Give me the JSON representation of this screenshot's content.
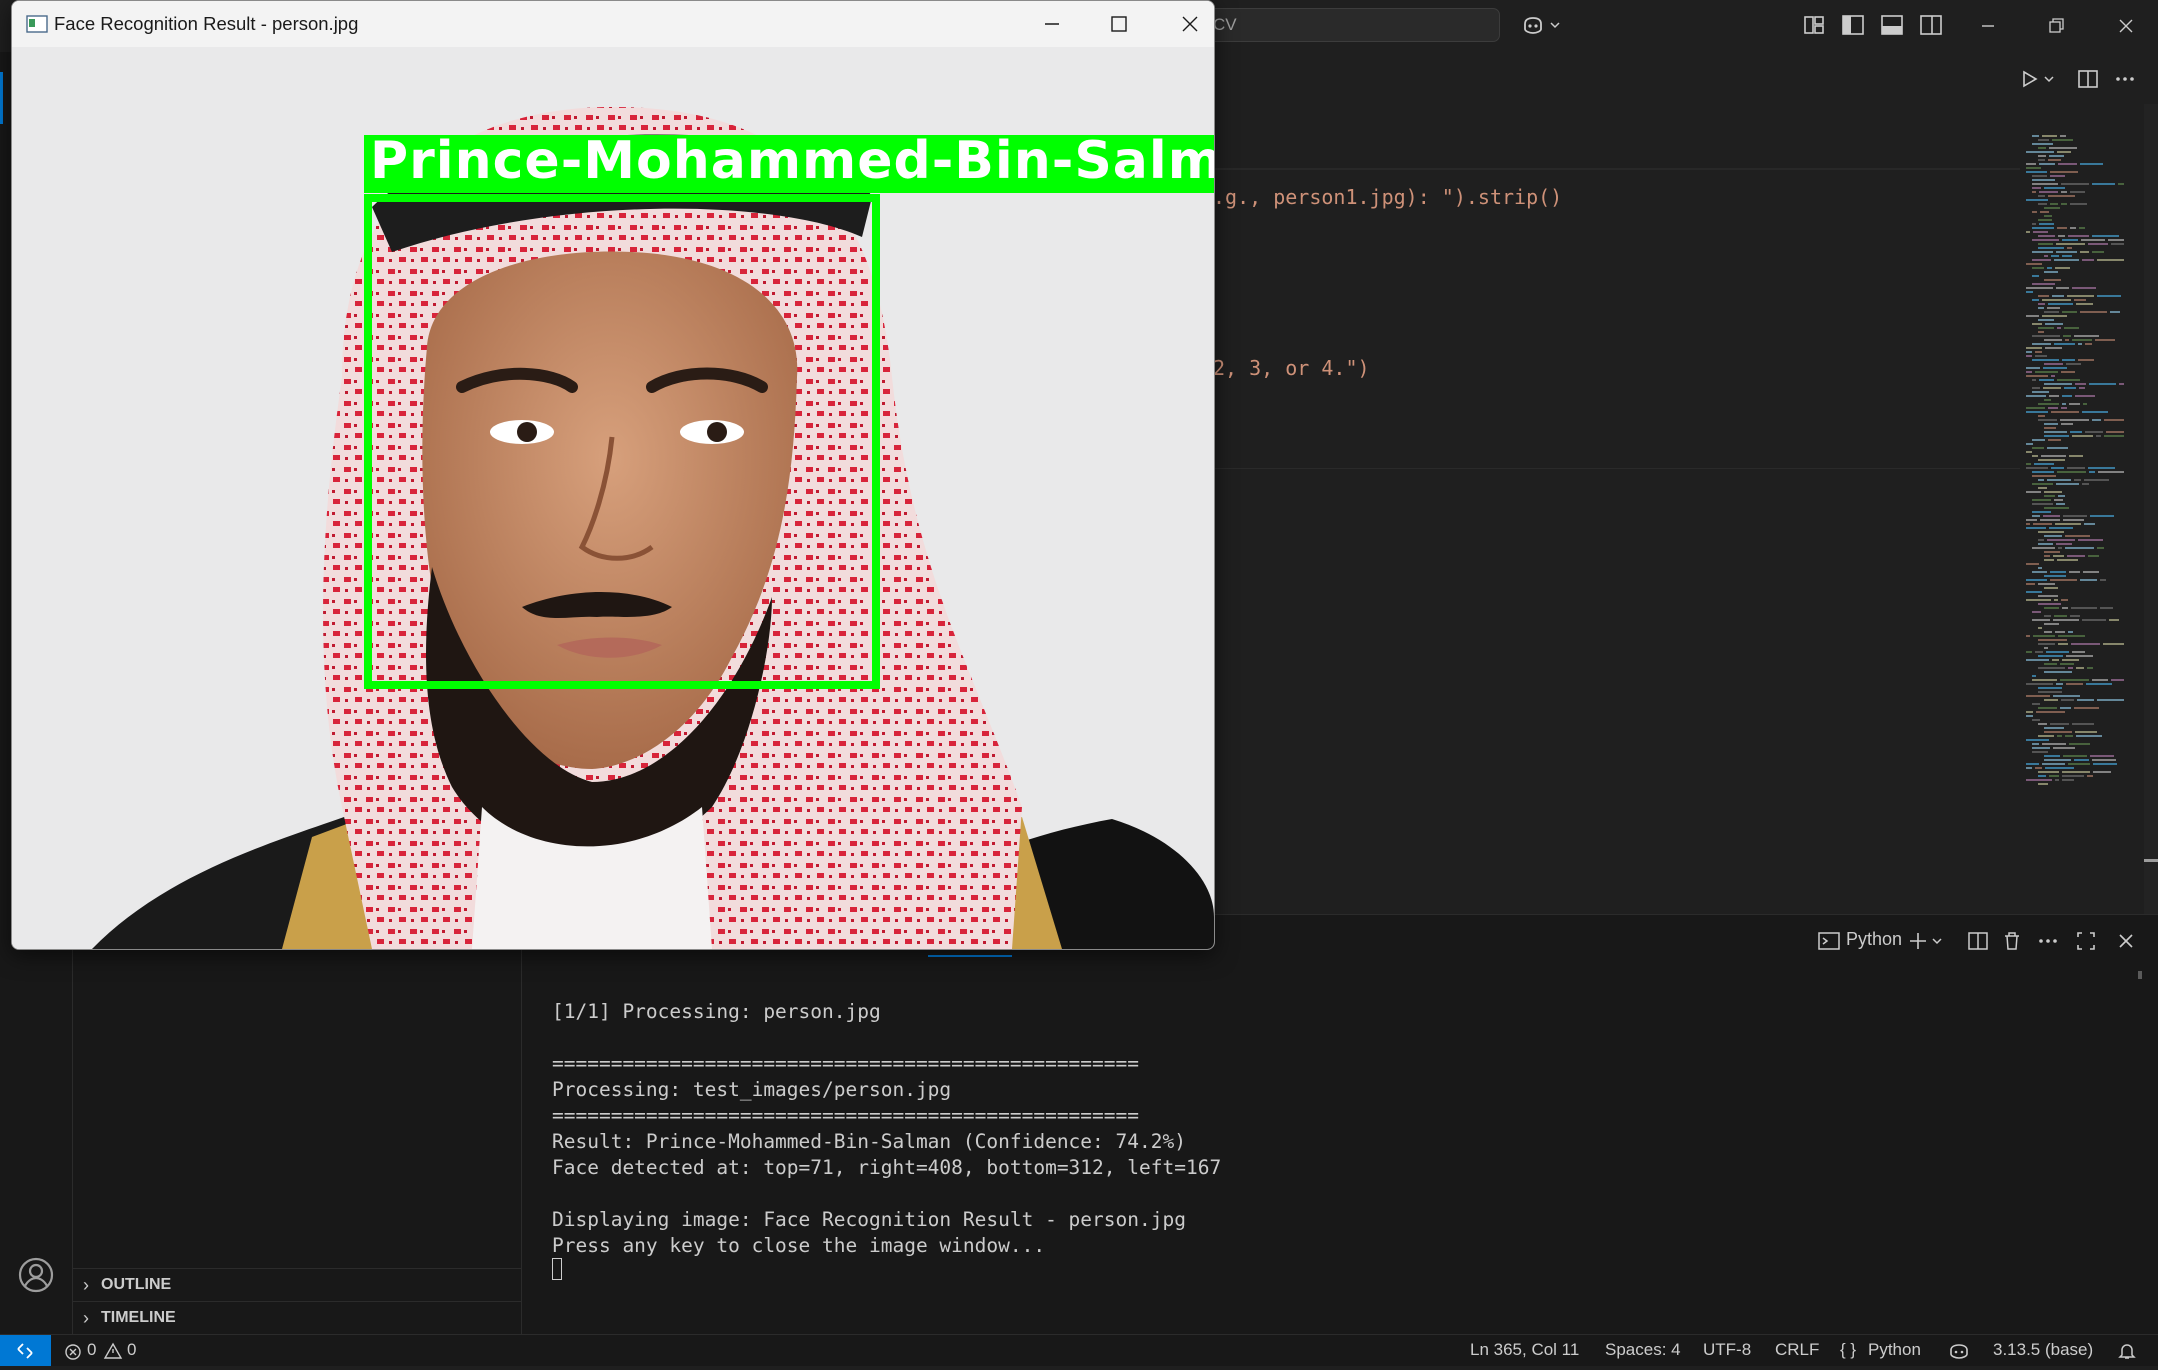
{
  "titlebar": {
    "command_center_text": "CV",
    "icons": [
      "copilot-icon",
      "toggle-primary-sidebar-icon",
      "toggle-panel-icon",
      "toggle-secondary-sidebar-icon",
      "customize-layout-icon"
    ]
  },
  "editor": {
    "code_lines": [
      {
        "text": ".g., person1.jpg): \").strip()",
        "color": "#ce9178"
      },
      {
        "text": "2, 3, or 4.\")",
        "color": "#ce9178"
      }
    ],
    "toolbar_icons": [
      "run-icon",
      "run-dropdown-icon",
      "split-editor-icon",
      "more-actions-icon"
    ]
  },
  "cv_window": {
    "title": "Face Recognition Result - person.jpg",
    "label_text": "Prince-Mohammed-Bin-Salman",
    "box_color": "#00ff00"
  },
  "sidebar": {
    "sections": [
      {
        "label": "OUTLINE"
      },
      {
        "label": "TIMELINE"
      }
    ]
  },
  "panel": {
    "terminal_name": "Python",
    "lines": [
      "[1/1] Processing: person.jpg",
      "",
      "==================================================",
      "Processing: test_images/person.jpg",
      "==================================================",
      "Result: Prince-Mohammed-Bin-Salman (Confidence: 74.2%)",
      "Face detected at: top=71, right=408, bottom=312, left=167",
      "",
      "Displaying image: Face Recognition Result - person.jpg",
      "Press any key to close the image window..."
    ]
  },
  "statusbar": {
    "errors": "0",
    "warnings": "0",
    "cursor_position": "Ln 365, Col 11",
    "indent": "Spaces: 4",
    "encoding": "UTF-8",
    "eol": "CRLF",
    "language": "Python",
    "interpreter": "3.13.5 (base)",
    "language_braces": "{ }"
  },
  "colors": {
    "accent": "#0078d4",
    "string": "#ce9178",
    "paren": "#ffd700"
  }
}
